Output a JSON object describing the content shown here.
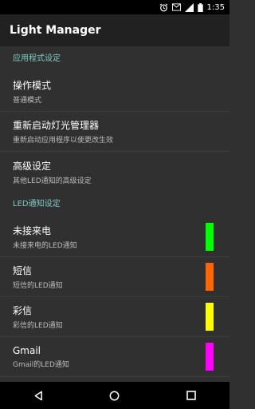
{
  "status_bar": {
    "time": "1:35"
  },
  "app_bar": {
    "title": "Light Manager"
  },
  "sections": [
    {
      "header": "应用程式设定",
      "items": [
        {
          "title": "操作模式",
          "summary": "普通模式"
        },
        {
          "title": "重新启动灯光管理器",
          "summary": "重新启动应用程序以使更改生效"
        },
        {
          "title": "高级设定",
          "summary": "其他LED通知的高级设定"
        }
      ]
    },
    {
      "header": "LED通知设定",
      "items": [
        {
          "title": "未接来电",
          "summary": "未接来电的LED通知",
          "color": "#00ff00"
        },
        {
          "title": "短信",
          "summary": "短信的LED通知",
          "color": "#ff6600"
        },
        {
          "title": "彩信",
          "summary": "彩信的LED通知",
          "color": "#ffff00"
        },
        {
          "title": "Gmail",
          "summary": "Gmail的LED通知",
          "color": "#ff00ff"
        },
        {
          "title": "",
          "summary": "",
          "color": "#0000ff"
        }
      ]
    }
  ],
  "icons": {
    "alarm": "alarm-icon",
    "notification": "mail-notification-icon",
    "signal": "signal-icon",
    "battery": "battery-icon",
    "back": "back-icon",
    "home": "home-icon",
    "recents": "recents-icon"
  }
}
